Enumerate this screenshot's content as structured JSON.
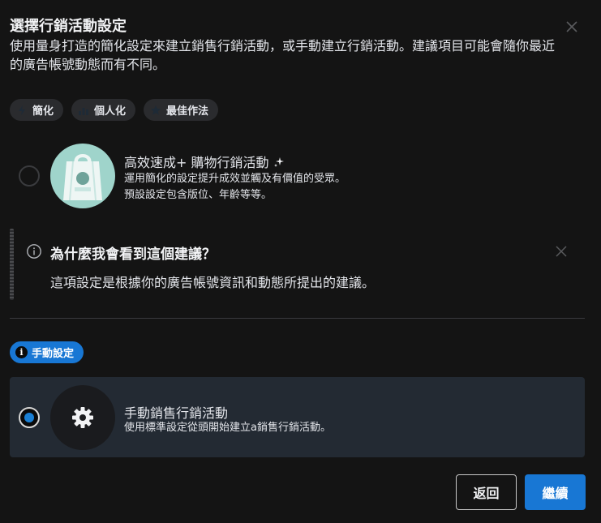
{
  "dialog": {
    "title": "選擇行銷活動設定",
    "subtitle": "使用量身打造的簡化設定來建立銷售行銷活動，或手動建立行銷活動。建議項目可能會隨你最近的廣告帳號動態而有不同。"
  },
  "tags": [
    {
      "label": "簡化",
      "icon": "lightning-icon"
    },
    {
      "label": "個人化",
      "icon": "bar-chart-icon"
    },
    {
      "label": "最佳作法",
      "icon": "star-icon"
    }
  ],
  "option1": {
    "title": "高效速成+ 購物行銷活動",
    "desc_line1": "運用簡化的設定提升成效並觸及有價值的受眾。",
    "desc_line2": "預設設定包含版位、年齡等等。",
    "selected": false
  },
  "why": {
    "title": "為什麼我會看到這個建議？",
    "body": "這項設定是根據你的廣告帳號資訊和動態所提出的建議。"
  },
  "manual": {
    "badge": "手動設定",
    "title": "手動銷售行銷活動",
    "desc": "使用標準設定從頭開始建立a銷售行銷活動。",
    "selected": true
  },
  "buttons": {
    "back": "返回",
    "next": "繼續"
  },
  "colors": {
    "background": "#141414",
    "accent": "#1877d4",
    "card_selected": "#232a33",
    "tag_bg": "#2a2b2e",
    "option1_image": "#9fd4cb"
  }
}
